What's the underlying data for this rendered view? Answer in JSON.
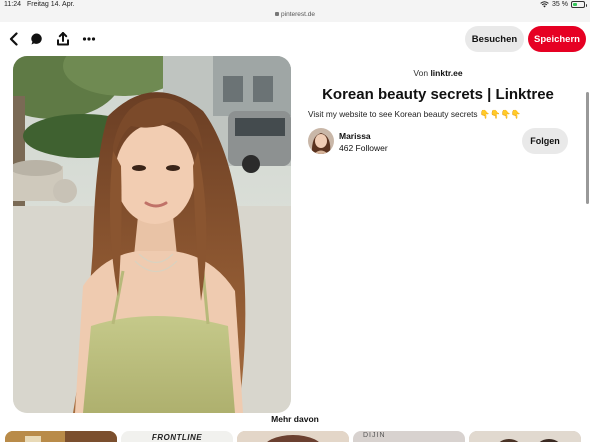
{
  "status_bar": {
    "time": "11:24",
    "date": "Freitag 14. Apr.",
    "url": "pinterest.de",
    "battery_percent": "35 %",
    "battery_level": 0.35
  },
  "toolbar": {
    "back_icon": "chevron-left-icon",
    "comment_icon": "speech-bubble-icon",
    "share_icon": "share-upload-icon",
    "more_icon": "ellipsis-icon",
    "visit_label": "Besuchen",
    "save_label": "Speichern"
  },
  "colors": {
    "brand_red": "#e60023",
    "pill_grey": "#e9e9e9"
  },
  "pin": {
    "source_prefix": "Von",
    "source_domain": "linktr.ee",
    "title": "Korean beauty secrets | Linktree",
    "description": "Visit my website to see Korean beauty secrets 👇👇👇👇",
    "visual_search_icon": "lens-search-icon"
  },
  "creator": {
    "name": "Marissa",
    "followers": "462 Follower",
    "follow_label": "Folgen"
  },
  "more_section": {
    "heading": "Mehr davon",
    "thumbnails": [
      {
        "text": ""
      },
      {
        "text": "FRONTLINE"
      },
      {
        "text": ""
      },
      {
        "text": "DIJIN"
      },
      {
        "text": ""
      }
    ]
  }
}
